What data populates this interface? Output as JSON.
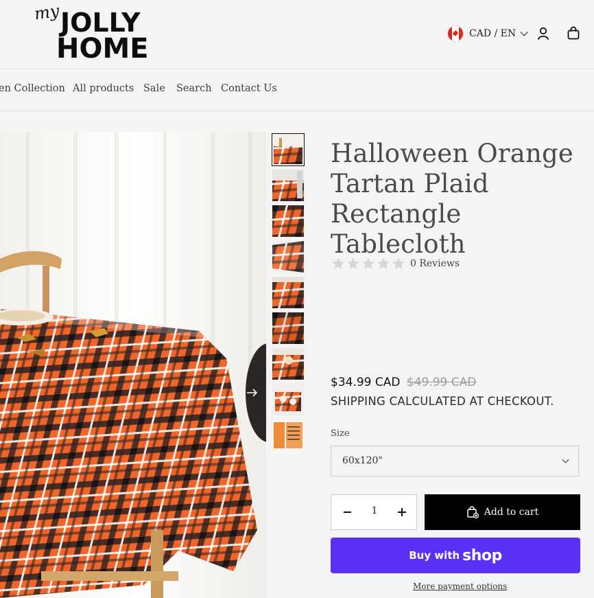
{
  "logo": {
    "script": "my",
    "line1": "JOLLY",
    "line2": "HOME"
  },
  "header": {
    "locale": "CAD / EN",
    "icons": [
      "canada-flag-icon",
      "chevron-down-icon",
      "account-icon",
      "cart-icon"
    ]
  },
  "nav": {
    "items": [
      "en Collection",
      "All products",
      "Sale",
      "Search",
      "Contact Us"
    ]
  },
  "product": {
    "title": "Halloween Orange Tartan Plaid Rectangle Tablecloth",
    "rating": 0,
    "reviews": "0 Reviews",
    "price": "$34.99 CAD",
    "compare_price": "$49.99 CAD",
    "shipping": "SHIPPING CALCULATED AT CHECKOUT.",
    "size_label": "Size",
    "size_value": "60x120\"",
    "quantity": "1",
    "add_to_cart": "Add to cart",
    "buy_with": "Buy with",
    "shop_brand": "shop",
    "more_payment": "More payment options"
  },
  "gallery": {
    "thumbnail_count": 9,
    "active_thumbnail": 1
  },
  "colors": {
    "accent_shop": "#5a31f4",
    "button_black": "#000000",
    "plaid_orange": "#f2652a"
  }
}
